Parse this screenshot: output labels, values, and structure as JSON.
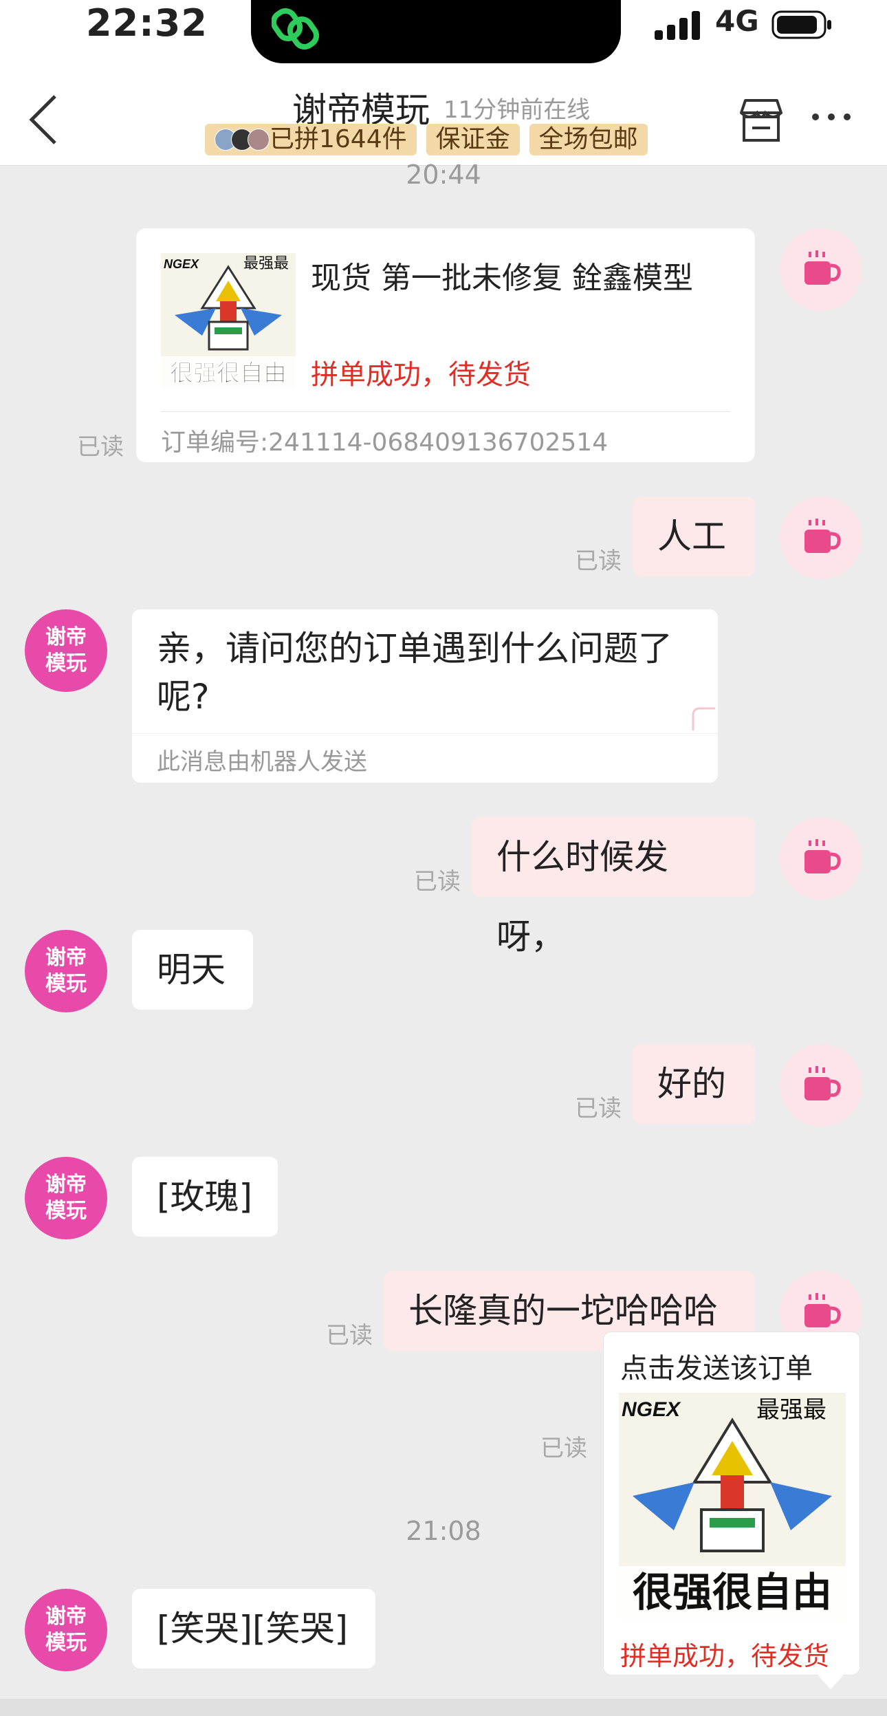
{
  "status_bar": {
    "time": "22:32",
    "network": "4G"
  },
  "header": {
    "shop_name": "谢帝模玩",
    "online_status": "11分钟前在线",
    "badges": [
      "已拼1644件",
      "保证金",
      "全场包邮"
    ]
  },
  "chat": {
    "timestamps": [
      "20:44",
      "21:08"
    ],
    "read_label": "已读",
    "shop_avatar_lines": [
      "谢帝",
      "模玩"
    ],
    "order_card": {
      "title": "现货 第一批未修复 銓鑫模型",
      "status": "拼单成功，待发货",
      "order_number": "订单编号:241114-068409136702514",
      "thumb_text": "很强很自由"
    },
    "messages": [
      {
        "from": "self",
        "text": "人工"
      },
      {
        "from": "shop",
        "text": "亲，请问您的订单遇到什么问题了呢?",
        "note": "此消息由机器人发送"
      },
      {
        "from": "self",
        "text": "什么时候发呀，"
      },
      {
        "from": "shop",
        "text": "明天"
      },
      {
        "from": "self",
        "text": "好的"
      },
      {
        "from": "shop",
        "text": "[玫瑰]"
      },
      {
        "from": "self",
        "text": "长隆真的一坨哈哈哈"
      },
      {
        "from": "shop",
        "text": "[笑哭][笑哭]"
      }
    ]
  },
  "popup": {
    "title": "点击发送该订单",
    "status": "拼单成功，待发货",
    "image_text": "很强很自由"
  },
  "colors": {
    "accent_red": "#e02e24",
    "shop_avatar": "#e84aa9",
    "self_bubble": "#fde8ea",
    "badge_bg": "#f3d9a8"
  }
}
